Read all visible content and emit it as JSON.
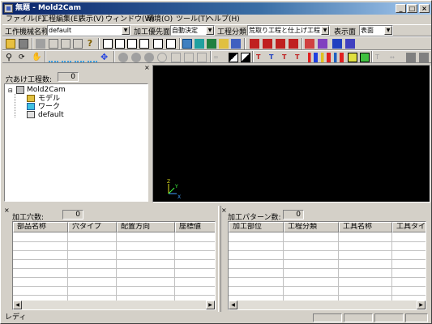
{
  "window": {
    "title": "無題 - Mold2Cam"
  },
  "menu": [
    "ファイル(F)",
    "工程編集(E)",
    "表示(V)",
    "ウィンドウ(W)",
    "環境(O)",
    "ツール(T)",
    "ヘルプ(H)"
  ],
  "toolbar1": {
    "template_label": "工作機械名称",
    "template_value": "default",
    "priority_label": "加工優先面",
    "priority_value": "自動決定",
    "category_label": "工程分類",
    "category_value": "荒取り工程と仕上げ工程",
    "display_label": "表示面",
    "display_value": "表面"
  },
  "left_panel": {
    "count_label": "穴あけ工程数:",
    "count_value": "0",
    "tree": {
      "root": "Mold2Cam",
      "children": [
        "モデル",
        "ワーク",
        "default"
      ]
    }
  },
  "viewport": {
    "background": "#000000",
    "axes": {
      "x": "X",
      "y": "Y",
      "z": "Z"
    }
  },
  "bottom_left": {
    "count_label": "加工穴数:",
    "count_value": "0",
    "columns": [
      "部品名称",
      "穴タイプ",
      "配置方向",
      "座標値"
    ]
  },
  "bottom_right": {
    "count_label": "加工パターン数:",
    "count_value": "0",
    "columns": [
      "加工部位",
      "工程分類",
      "工具名称",
      "工具タイプ"
    ]
  },
  "statusbar": {
    "text": "レディ"
  }
}
